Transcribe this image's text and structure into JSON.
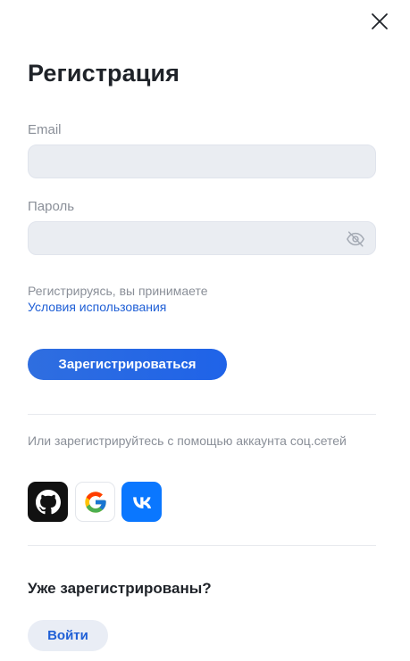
{
  "dialog": {
    "title": "Регистрация"
  },
  "form": {
    "email": {
      "label": "Email",
      "value": "",
      "placeholder": ""
    },
    "password": {
      "label": "Пароль",
      "value": "",
      "placeholder": ""
    },
    "terms_text": "Регистрируясь, вы принимаете",
    "terms_link": "Условия использования",
    "submit_label": "Зарегистрироваться"
  },
  "social": {
    "prompt": "Или зарегистрируйтесь с помощью аккаунта соц.сетей",
    "providers": [
      {
        "name": "GitHub",
        "icon": "github-icon"
      },
      {
        "name": "Google",
        "icon": "google-icon"
      },
      {
        "name": "VK",
        "icon": "vk-icon"
      }
    ]
  },
  "login": {
    "heading": "Уже зарегистрированы?",
    "button_label": "Войти"
  },
  "colors": {
    "accent": "#1f63e8",
    "link": "#1f5fd6",
    "input_bg": "#eaedf2",
    "muted_text": "#8a8f98",
    "secondary_button_bg": "#e9edf5",
    "github_bg": "#111111",
    "vk_bg": "#0a77ff"
  }
}
